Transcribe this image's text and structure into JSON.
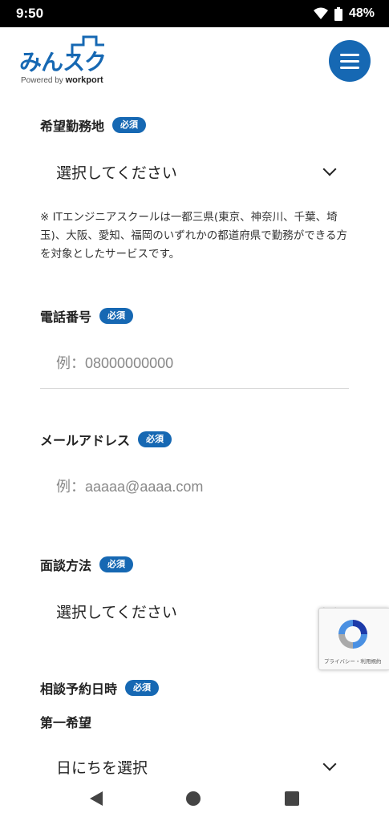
{
  "status_bar": {
    "time": "9:50",
    "battery": "48%"
  },
  "header": {
    "brand_text": "みんスク",
    "powered_by": "Powered by",
    "powered_brand": "workport",
    "menu_icon": "hamburger-menu-icon"
  },
  "form": {
    "work_location": {
      "label": "希望勤務地",
      "required": "必須",
      "value": "選択してください"
    },
    "note": "※ ITエンジニアスクールは一都三県(東京、神奈川、千葉、埼玉)、大阪、愛知、福岡のいずれかの都道府県で勤務ができる方を対象としたサービスです。",
    "phone": {
      "label": "電話番号",
      "required": "必須",
      "placeholder": "例：08000000000"
    },
    "email": {
      "label": "メールアドレス",
      "required": "必須",
      "placeholder": "例：aaaaa@aaaa.com"
    },
    "interview_method": {
      "label": "面談方法",
      "required": "必須",
      "value": "選択してください"
    },
    "consult_datetime": {
      "label": "相談予約日時",
      "required": "必須",
      "first_choice": "第一希望",
      "date_value": "日にちを選択"
    }
  },
  "recaptcha": {
    "text": "プライバシー・利用規約"
  },
  "colors": {
    "accent": "#1668b3"
  }
}
